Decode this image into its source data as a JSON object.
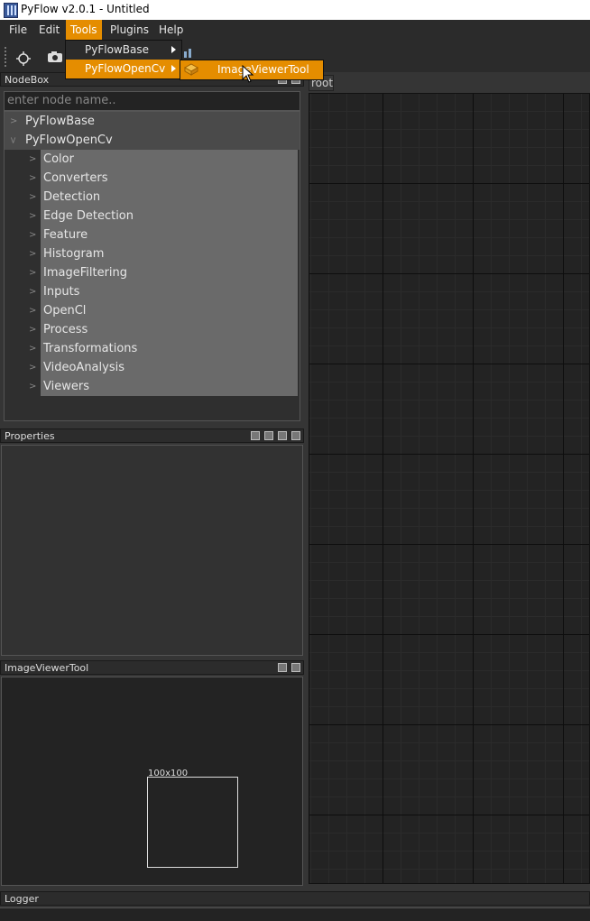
{
  "window": {
    "title": "PyFlow v2.0.1 - Untitled"
  },
  "menubar": {
    "items": [
      {
        "label": "File"
      },
      {
        "label": "Edit"
      },
      {
        "label": "Tools"
      },
      {
        "label": "Plugins"
      },
      {
        "label": "Help"
      }
    ]
  },
  "tools_menu": {
    "items": [
      {
        "label": "PyFlowBase"
      },
      {
        "label": "PyFlowOpenCv"
      }
    ]
  },
  "submenu": {
    "items": [
      {
        "label": "ImageViewerTool"
      }
    ]
  },
  "nodebox": {
    "title": "NodeBox",
    "search_placeholder": "enter node name..",
    "tree": [
      {
        "label": "PyFlowBase",
        "expanded": false
      },
      {
        "label": "PyFlowOpenCv",
        "expanded": true,
        "children": [
          "Color",
          "Converters",
          "Detection",
          "Edge Detection",
          "Feature",
          "Histogram",
          "ImageFiltering",
          "Inputs",
          "OpenCl",
          "Process",
          "Transformations",
          "VideoAnalysis",
          "Viewers"
        ]
      }
    ]
  },
  "properties": {
    "title": "Properties"
  },
  "image_viewer": {
    "title": "ImageViewerTool",
    "rect_label": "100x100"
  },
  "graph": {
    "tab": "root"
  },
  "logger": {
    "title": "Logger"
  },
  "colors": {
    "accent": "#e58d00",
    "background": "#353535",
    "canvas": "#232323"
  }
}
